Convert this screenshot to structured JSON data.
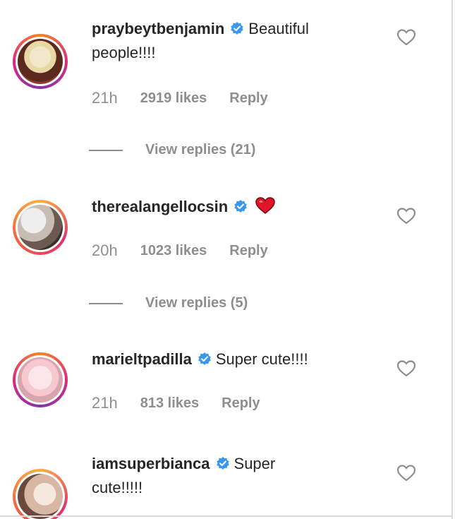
{
  "comments": [
    {
      "username": "praybeytbenjamin",
      "text_line1": "Beautiful",
      "text_line2": "people!!!!",
      "time": "21h",
      "likes": "2919 likes",
      "reply": "Reply",
      "view_replies": "View replies (21)"
    },
    {
      "username": "therealangellocsin",
      "text_line1": "",
      "time": "20h",
      "likes": "1023 likes",
      "reply": "Reply",
      "view_replies": "View replies (5)"
    },
    {
      "username": "marieltpadilla",
      "text_line1": "Super cute!!!!",
      "time": "21h",
      "likes": "813 likes",
      "reply": "Reply"
    },
    {
      "username": "iamsuperbianca",
      "text_line1": "Super",
      "text_line2": "cute!!!!!"
    }
  ],
  "colors": {
    "verified": "#3897f0",
    "meta_text": "#8e8e8e",
    "primary_text": "#262626",
    "heart_emoji": "#e0152a"
  }
}
